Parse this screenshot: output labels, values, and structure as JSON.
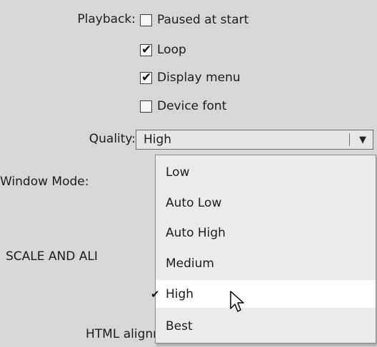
{
  "playback": {
    "label": "Playback:",
    "options": [
      {
        "label": "Paused at start",
        "checked": false
      },
      {
        "label": "Loop",
        "checked": true
      },
      {
        "label": "Display menu",
        "checked": true
      },
      {
        "label": "Device font",
        "checked": false
      }
    ]
  },
  "quality": {
    "label": "Quality:",
    "value": "High",
    "options": [
      "Low",
      "Auto Low",
      "Auto High",
      "Medium",
      "High",
      "Best"
    ],
    "selected": "High",
    "check_glyph": "✔"
  },
  "window_mode": {
    "label": "Window Mode:"
  },
  "scale_align": {
    "label_partial": "SCALE AND ALI"
  },
  "html_alignment": {
    "label_partial": "HTML alignment: Default"
  },
  "icons": {
    "check": "check-icon",
    "dropdown": "dropdown-arrow-icon",
    "cursor": "mouse-pointer-icon"
  },
  "colors": {
    "panel_background": "#d7d7d7",
    "menu_background": "#ebebeb",
    "menu_selected_background": "#ffffff",
    "border": "#6a6a6a"
  }
}
